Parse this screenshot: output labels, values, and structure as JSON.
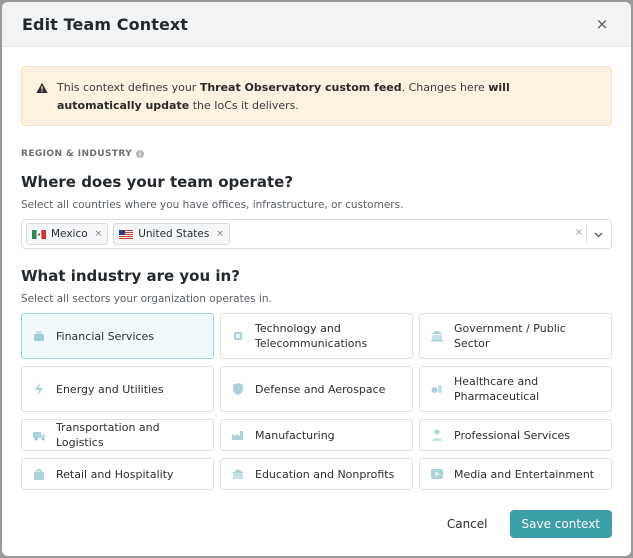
{
  "modal": {
    "title": "Edit Team Context",
    "close_label": "×"
  },
  "alert": {
    "text_1": "This context defines your ",
    "bold_1": "Threat Observatory custom feed",
    "text_2": ". Changes here ",
    "bold_2": "will automatically update",
    "text_3": " the IoCs it delivers."
  },
  "section": {
    "label": "REGION & INDUSTRY"
  },
  "region": {
    "heading": "Where does your team operate?",
    "sub": "Select all countries where you have offices, infrastructure, or customers.",
    "chips": [
      {
        "label": "Mexico",
        "remove": "×"
      },
      {
        "label": "United States",
        "remove": "×"
      }
    ],
    "clear": "×"
  },
  "industry": {
    "heading": "What industry are you in?",
    "sub": "Select all sectors your organization operates in.",
    "tiles": [
      {
        "label": "Financial Services",
        "selected": true
      },
      {
        "label": "Technology and Telecommunications",
        "selected": false
      },
      {
        "label": "Government / Public Sector",
        "selected": false
      },
      {
        "label": "Energy and Utilities",
        "selected": false
      },
      {
        "label": "Defense and Aerospace",
        "selected": false
      },
      {
        "label": "Healthcare and Pharmaceutical",
        "selected": false
      },
      {
        "label": "Transportation and Logistics",
        "selected": false
      },
      {
        "label": "Manufacturing",
        "selected": false
      },
      {
        "label": "Professional Services",
        "selected": false
      },
      {
        "label": "Retail and Hospitality",
        "selected": false
      },
      {
        "label": "Education and Nonprofits",
        "selected": false
      },
      {
        "label": "Media and Entertainment",
        "selected": false
      }
    ]
  },
  "footer": {
    "cancel_label": "Cancel",
    "save_label": "Save context"
  },
  "colors": {
    "accent": "#3c9ea9",
    "alert_bg": "#fdf1df",
    "selected_tile_bg": "#f1fafb"
  }
}
